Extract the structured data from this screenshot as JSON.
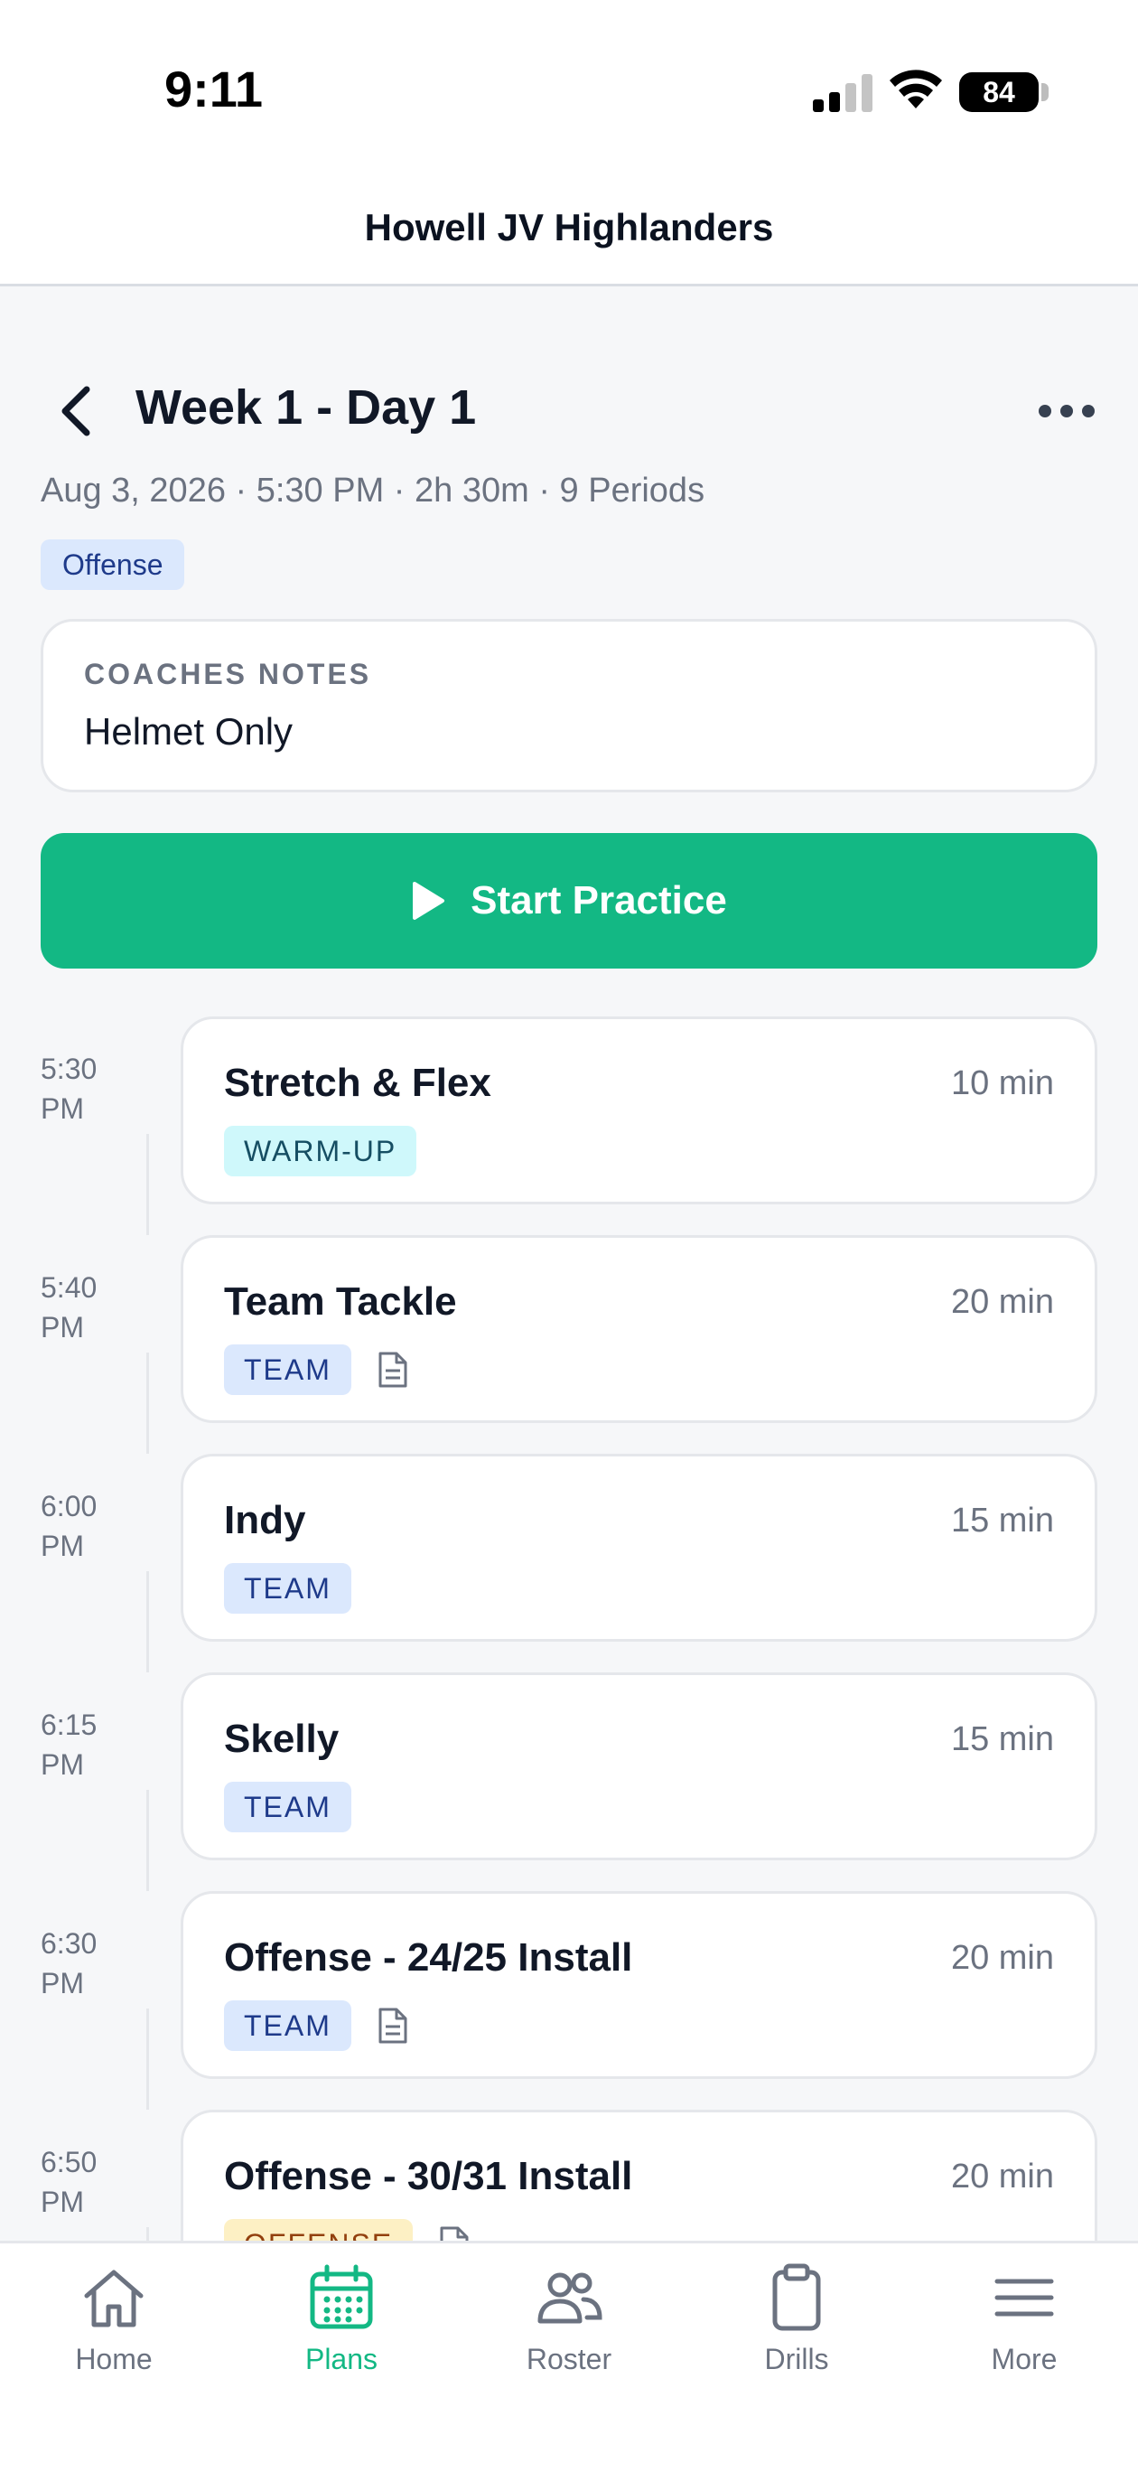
{
  "status_bar": {
    "time": "9:11",
    "battery": "84"
  },
  "header": {
    "title": "Howell JV Highlanders"
  },
  "page": {
    "title": "Week 1 - Day 1",
    "meta": "Aug 3, 2026 · 5:30 PM · 2h 30m · 9 Periods",
    "tag": "Offense"
  },
  "notes": {
    "label": "COACHES NOTES",
    "text": "Helmet Only"
  },
  "start_button": {
    "label": "Start Practice"
  },
  "periods": [
    {
      "time_line1": "5:30",
      "time_line2": "PM",
      "name": "Stretch & Flex",
      "duration": "10 min",
      "tag": "WARM-UP",
      "tag_bg": "#cff8fb",
      "tag_fg": "#164e63",
      "has_doc": false
    },
    {
      "time_line1": "5:40",
      "time_line2": "PM",
      "name": "Team Tackle",
      "duration": "20 min",
      "tag": "TEAM",
      "tag_bg": "#dbe8fd",
      "tag_fg": "#1e3a8a",
      "has_doc": true
    },
    {
      "time_line1": "6:00",
      "time_line2": "PM",
      "name": "Indy",
      "duration": "15 min",
      "tag": "TEAM",
      "tag_bg": "#dbe8fd",
      "tag_fg": "#1e3a8a",
      "has_doc": false
    },
    {
      "time_line1": "6:15",
      "time_line2": "PM",
      "name": "Skelly",
      "duration": "15 min",
      "tag": "TEAM",
      "tag_bg": "#dbe8fd",
      "tag_fg": "#1e3a8a",
      "has_doc": false
    },
    {
      "time_line1": "6:30",
      "time_line2": "PM",
      "name": "Offense - 24/25 Install",
      "duration": "20 min",
      "tag": "TEAM",
      "tag_bg": "#dbe8fd",
      "tag_fg": "#1e3a8a",
      "has_doc": true
    },
    {
      "time_line1": "6:50",
      "time_line2": "PM",
      "name": "Offense - 30/31 Install",
      "duration": "20 min",
      "tag": "OFFENSE",
      "tag_bg": "#fdf0c4",
      "tag_fg": "#92400e",
      "has_doc": true
    }
  ],
  "nav": [
    {
      "label": "Home",
      "icon": "home-icon",
      "active": false
    },
    {
      "label": "Plans",
      "icon": "calendar-icon",
      "active": true
    },
    {
      "label": "Roster",
      "icon": "people-icon",
      "active": false
    },
    {
      "label": "Drills",
      "icon": "clipboard-icon",
      "active": false
    },
    {
      "label": "More",
      "icon": "menu-icon",
      "active": false
    }
  ],
  "colors": {
    "accent": "#13b884",
    "muted": "#6b7280",
    "text": "#111827"
  }
}
